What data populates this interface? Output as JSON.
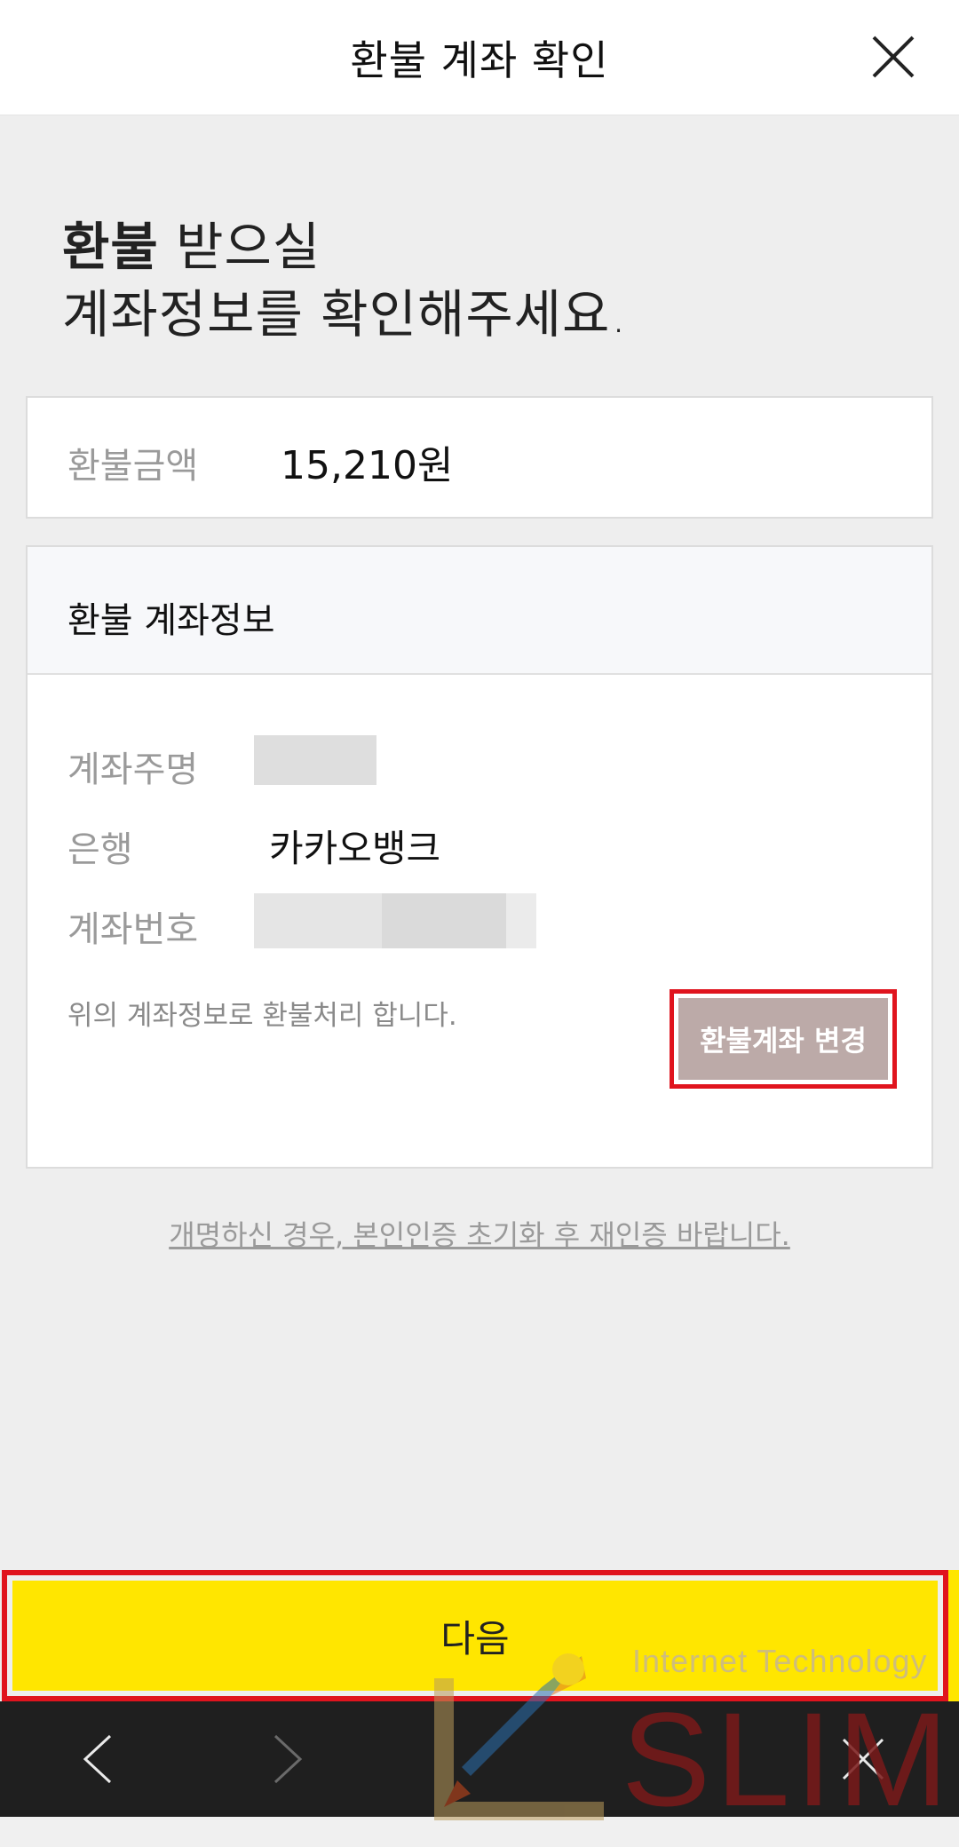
{
  "header": {
    "title": "환불 계좌 확인",
    "close_icon": "close-icon"
  },
  "heading": {
    "bold": "환불",
    "line1_rest": " 받으실",
    "line2": "계좌정보를 확인해주세요."
  },
  "amount": {
    "label": "환불금액",
    "value": "15,210원"
  },
  "account": {
    "title": "환불 계좌정보",
    "holder_label": "계좌주명",
    "bank_label": "은행",
    "bank_value": "카카오뱅크",
    "number_label": "계좌번호",
    "notice": "위의 계좌정보로 환불처리 합니다.",
    "change_button": "환불계좌 변경"
  },
  "rename_link": "개명하신 경우, 본인인증 초기화 후 재인증 바랍니다.",
  "next_button": "다음",
  "watermark": {
    "tagline": "Internet Technology",
    "brand": "SLIM"
  },
  "bottom_bar": {
    "icons": [
      "back-icon",
      "forward-icon",
      "close-icon"
    ]
  },
  "colors": {
    "accent_yellow": "#ffe600",
    "highlight_red": "#e0141e",
    "change_button_bg": "#bcaaa8",
    "background": "#eeeeee"
  }
}
